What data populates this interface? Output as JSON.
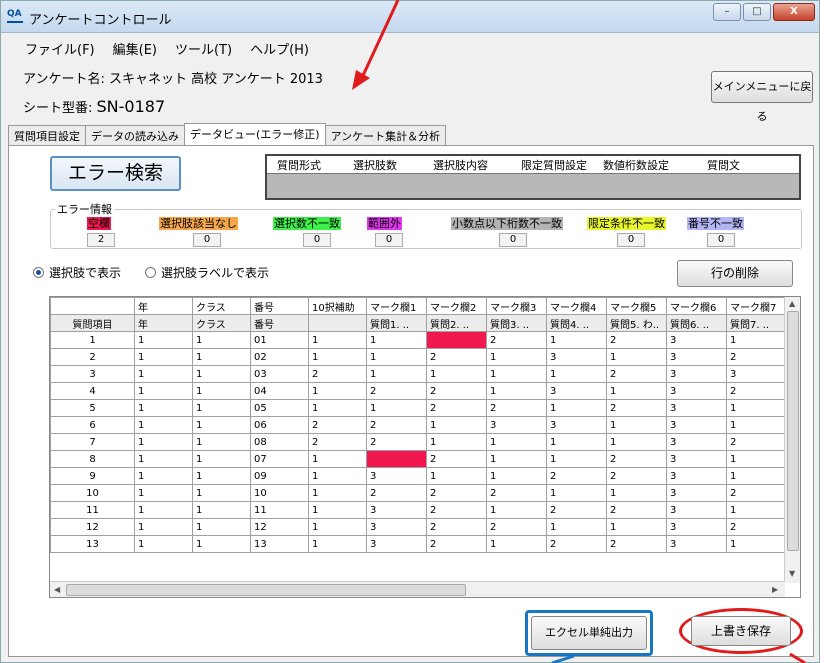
{
  "window": {
    "title": "アンケートコントロール",
    "app_icon": "QA",
    "min": "–",
    "max": "□",
    "close": "X"
  },
  "menu": [
    "ファイル(F)",
    "編集(E)",
    "ツール(T)",
    "ヘルプ(H)"
  ],
  "survey": {
    "name_label": "アンケート名: スキャネット 高校 アンケート 2013",
    "sheet_label": "シート型番: ",
    "sheet_value": "SN-0187"
  },
  "main_menu_button": "メインメニューに戻る",
  "tabs": [
    "質問項目設定",
    "データの読み込み",
    "データビュー(エラー修正)",
    "アンケート集計＆分析"
  ],
  "error_search_button": "エラー検索",
  "question_info_headers": [
    "質問形式",
    "選択肢数",
    "選択肢内容",
    "限定質問設定",
    "数値桁数設定",
    "質問文"
  ],
  "error_info": {
    "label": "エラー情報",
    "items": [
      {
        "label": "空欄",
        "count": "2",
        "color": "#f1174f"
      },
      {
        "label": "選択肢該当なし",
        "count": "0",
        "color": "#f7a64a"
      },
      {
        "label": "選択数不一致",
        "count": "0",
        "color": "#3ff04a"
      },
      {
        "label": "範囲外",
        "count": "0",
        "color": "#e236f0"
      },
      {
        "label": "小数点以下桁数不一致",
        "count": "0",
        "color": "#b3b3b3"
      },
      {
        "label": "限定条件不一致",
        "count": "0",
        "color": "#e7f52b"
      },
      {
        "label": "番号不一致",
        "count": "0",
        "color": "#b2b6f4"
      }
    ]
  },
  "display_mode": {
    "option1": "選択肢で表示",
    "option2": "選択肢ラベルで表示"
  },
  "row_delete_button": "行の削除",
  "grid": {
    "headers": [
      "",
      "年",
      "クラス",
      "番号",
      "10択補助",
      "マーク欄1",
      "マーク欄2",
      "マーク欄3",
      "マーク欄4",
      "マーク欄5",
      "マーク欄6",
      "マーク欄7"
    ],
    "subheaders": [
      "質問項目",
      "年",
      "クラス",
      "番号",
      "",
      "質問1. ..",
      "質問2. ..",
      "質問3. ..",
      "質問4. ..",
      "質問5. わ..",
      "質問6. ..",
      "質問7. .."
    ],
    "rows": [
      [
        "1",
        "1",
        "1",
        "01",
        "1",
        "1",
        "",
        "2",
        "1",
        "2",
        "3",
        "1"
      ],
      [
        "2",
        "1",
        "1",
        "02",
        "1",
        "1",
        "2",
        "1",
        "3",
        "1",
        "3",
        "2"
      ],
      [
        "3",
        "1",
        "1",
        "03",
        "2",
        "1",
        "1",
        "1",
        "1",
        "2",
        "3",
        "3"
      ],
      [
        "4",
        "1",
        "1",
        "04",
        "1",
        "2",
        "2",
        "1",
        "3",
        "1",
        "3",
        "2"
      ],
      [
        "5",
        "1",
        "1",
        "05",
        "1",
        "1",
        "2",
        "2",
        "1",
        "2",
        "3",
        "1"
      ],
      [
        "6",
        "1",
        "1",
        "06",
        "2",
        "2",
        "1",
        "3",
        "3",
        "1",
        "3",
        "1"
      ],
      [
        "7",
        "1",
        "1",
        "08",
        "2",
        "2",
        "1",
        "1",
        "1",
        "1",
        "3",
        "2"
      ],
      [
        "8",
        "1",
        "1",
        "07",
        "1",
        "",
        "2",
        "1",
        "1",
        "2",
        "3",
        "1"
      ],
      [
        "9",
        "1",
        "1",
        "09",
        "1",
        "3",
        "1",
        "1",
        "2",
        "2",
        "3",
        "1"
      ],
      [
        "10",
        "1",
        "1",
        "10",
        "1",
        "2",
        "2",
        "2",
        "1",
        "1",
        "3",
        "2"
      ],
      [
        "11",
        "1",
        "1",
        "11",
        "1",
        "3",
        "2",
        "1",
        "2",
        "2",
        "3",
        "1"
      ],
      [
        "12",
        "1",
        "1",
        "12",
        "1",
        "3",
        "2",
        "2",
        "1",
        "1",
        "3",
        "2"
      ],
      [
        "13",
        "1",
        "1",
        "13",
        "1",
        "3",
        "2",
        "1",
        "2",
        "2",
        "3",
        "1"
      ]
    ],
    "error_cells": [
      [
        0,
        6
      ],
      [
        7,
        5
      ]
    ]
  },
  "excel_button": "エクセル単純出力",
  "save_button": "上書き保存",
  "colors": {
    "error_fill": "#f1174f",
    "annotation_red": "#e01b1b",
    "annotation_blue": "#1777c4"
  }
}
